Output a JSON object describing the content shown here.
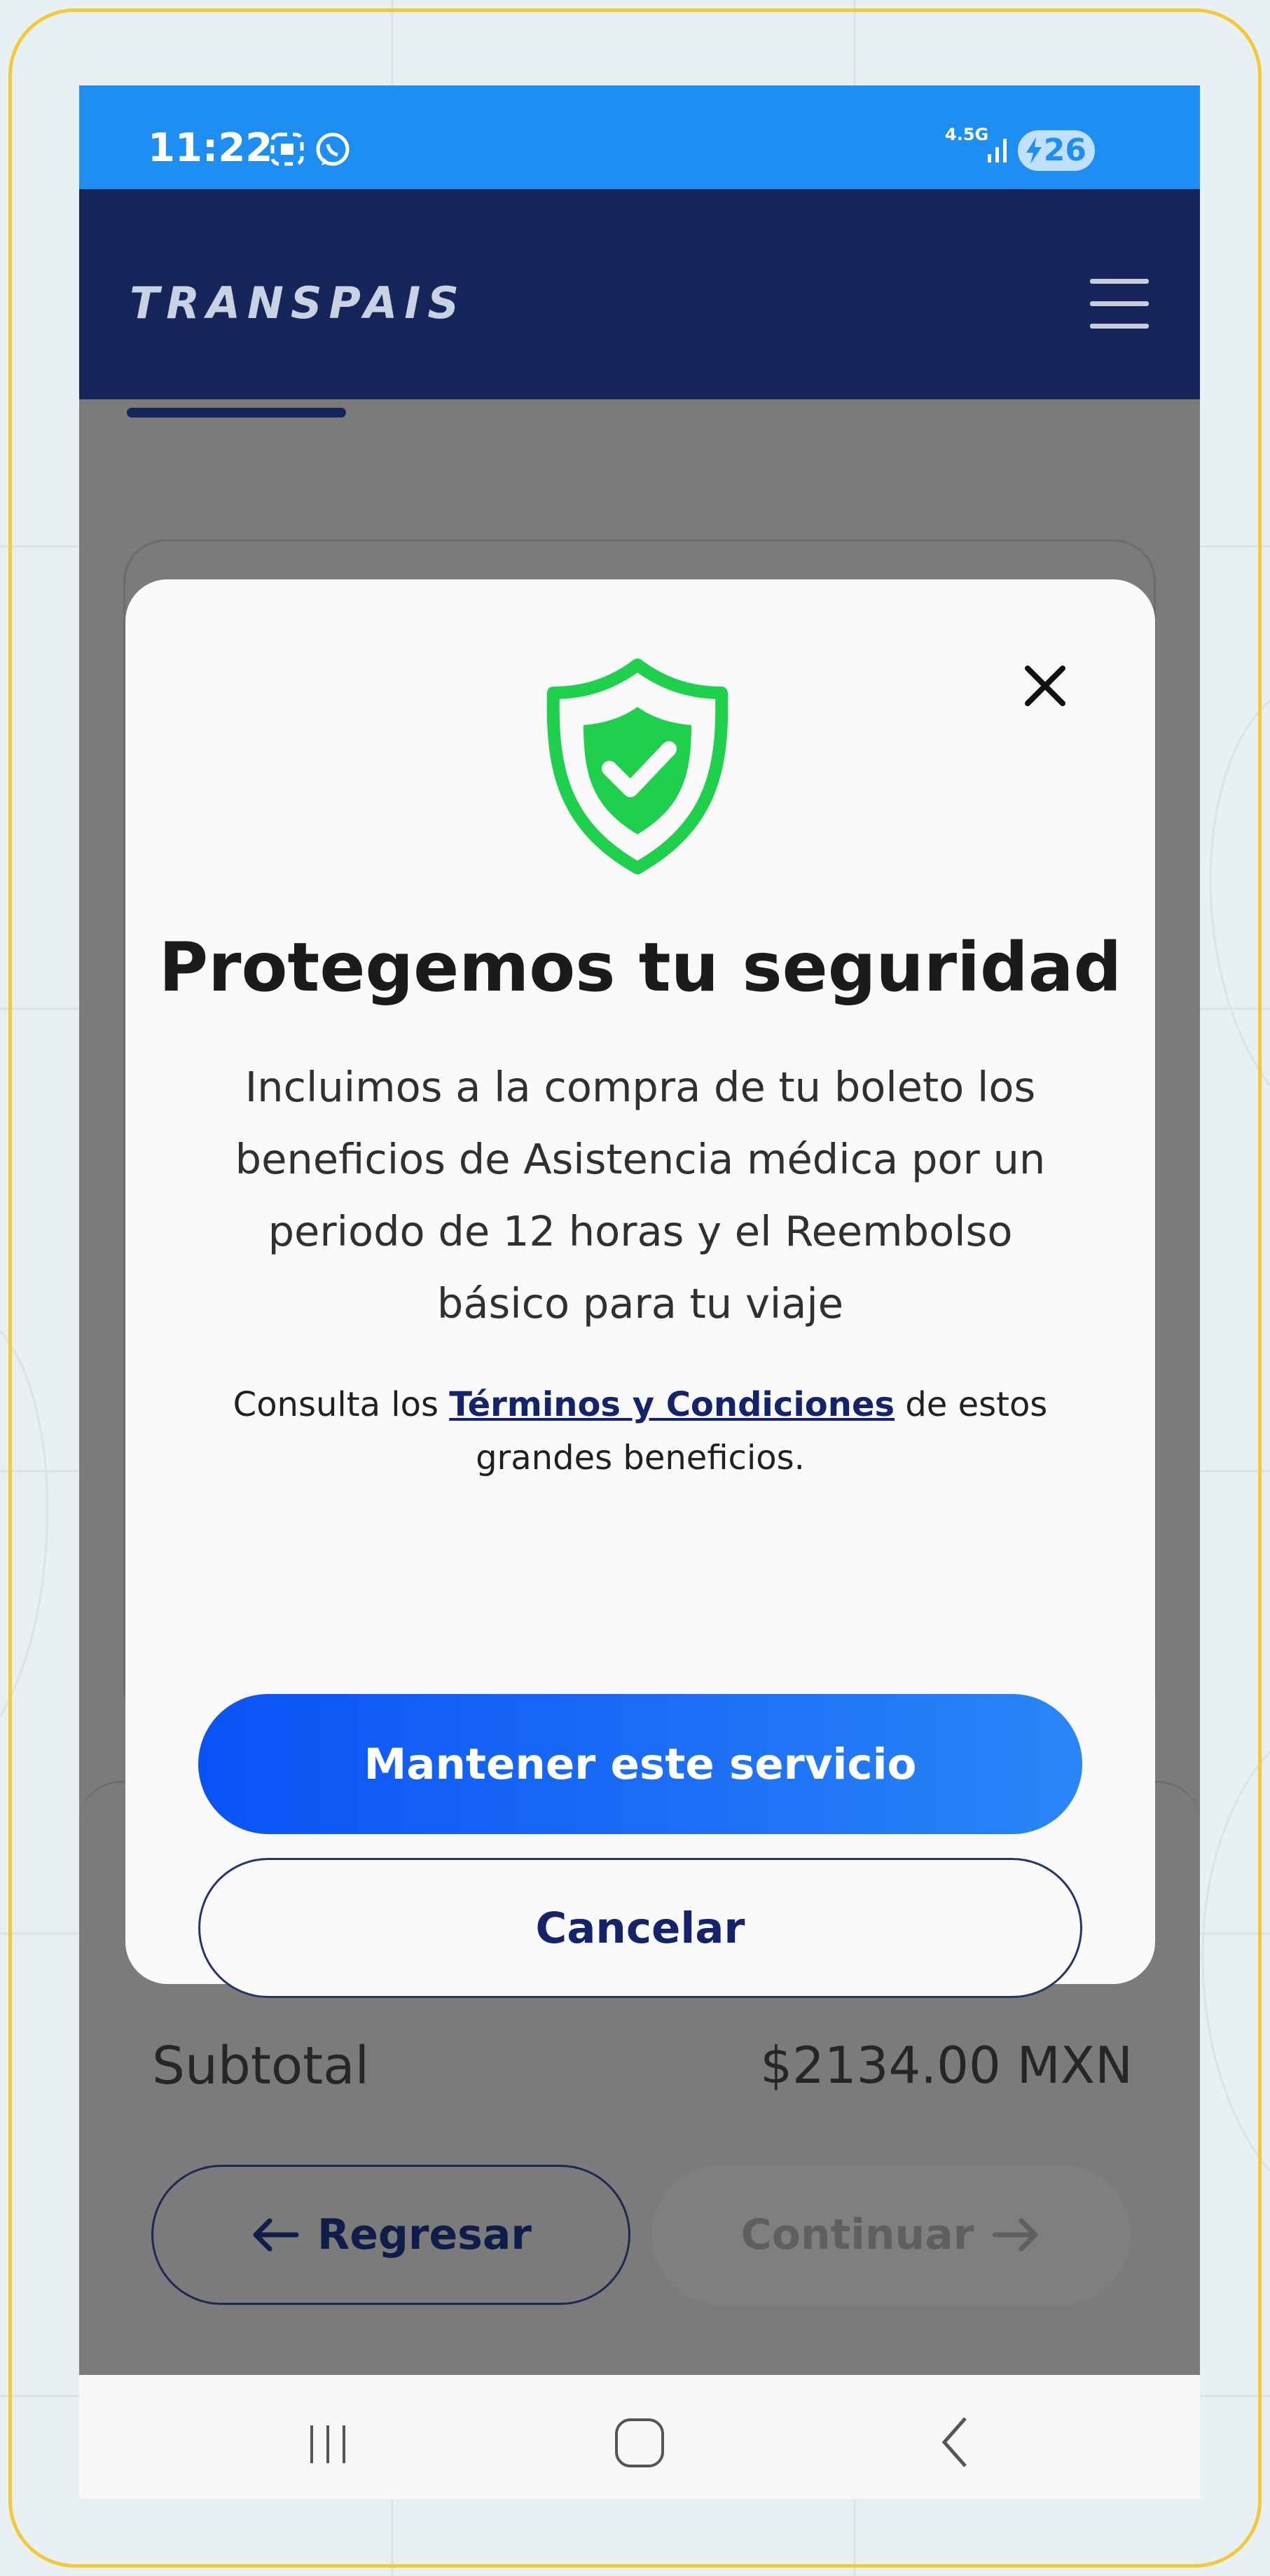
{
  "status_bar": {
    "time": "11:22",
    "network": "4.5G",
    "battery": "26",
    "icons": [
      "screenshot-icon",
      "whatsapp-icon",
      "signal-icon",
      "charging-icon"
    ]
  },
  "header": {
    "brand": "TRANSPAIS",
    "menu_icon": "hamburger-icon"
  },
  "progress": {
    "fraction": 0.214
  },
  "modal": {
    "icon": "shield-check-icon",
    "close_icon": "close-icon",
    "title": "Protegemos tu seguridad",
    "body": "Incluimos a la compra de tu boleto los beneficios de Asistencia médica por un periodo de 12 horas y el Reembolso básico para tu viaje",
    "terms_prefix": "Consulta los ",
    "terms_link": "Términos y Condiciones",
    "terms_suffix": " de estos grandes beneficios.",
    "primary_button": "Mantener este servicio",
    "secondary_button": "Cancelar"
  },
  "summary": {
    "subtotal_label": "Subtotal",
    "subtotal_value": "$2134.00 MXN"
  },
  "actions": {
    "back_label": "Regresar",
    "next_label": "Continuar"
  },
  "colors": {
    "status_bar": "#1f8ef3",
    "header": "#16265a",
    "primary_gradient_start": "#0a52f6",
    "primary_gradient_end": "#2a86f7",
    "shield": "#1fd04c",
    "frame_border": "#f1c93a"
  }
}
